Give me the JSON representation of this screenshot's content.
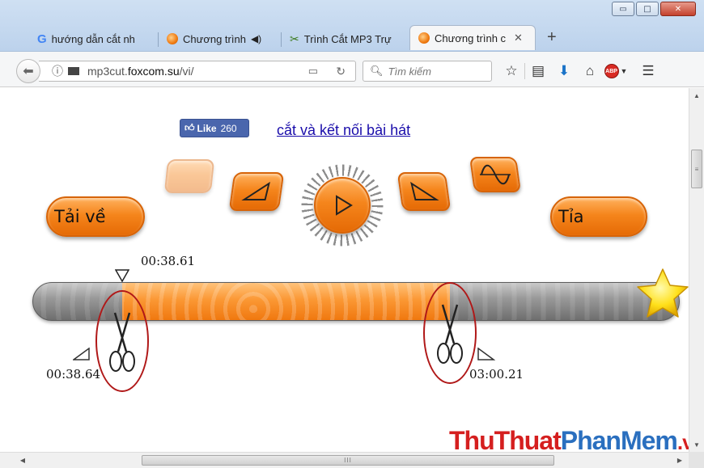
{
  "window": {
    "controls": {
      "minimize": "▭",
      "maximize": "□",
      "close": "✕"
    }
  },
  "tabs": [
    {
      "title": "hướng dẫn cắt nh",
      "icon": "google-icon",
      "active": false
    },
    {
      "title": "Chương trình",
      "icon": "orange-circle-icon",
      "active": false,
      "audio": true
    },
    {
      "title": "Trình Cắt MP3 Trự",
      "icon": "scissors-icon",
      "active": false
    },
    {
      "title": "Chương trình c",
      "icon": "orange-circle-icon",
      "active": true
    }
  ],
  "toolbar": {
    "url_prefix": "mp3cut.",
    "url_domain": "foxcom.su",
    "url_suffix": "/vi/",
    "search_placeholder": "Tìm kiếm",
    "abp_label": "ABP"
  },
  "page": {
    "like_label": "Like",
    "like_count": "260",
    "top_link": "cắt và kết nối bài hát",
    "download_button": "Tải về",
    "trim_button": "Tỉa",
    "time_marker": "00:38.61",
    "time_start": "00:38.64",
    "time_end": "03:00.21",
    "selection_start_fraction": 0.138,
    "selection_end_fraction": 0.646,
    "accent_color": "#f5851c"
  },
  "watermark": {
    "part1": "ThuThuat",
    "part2": "PhanMem",
    "part3": ".vn"
  },
  "scrollbar": {
    "grip": "III",
    "vgrip": "≡"
  }
}
